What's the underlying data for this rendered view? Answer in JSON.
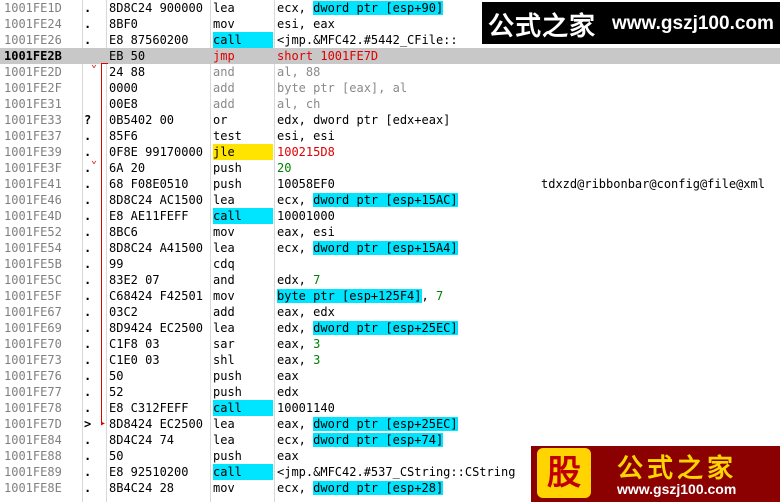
{
  "rows": [
    {
      "addr": "1001FE1D",
      "mark": ".",
      "hex": "8D8C24 900000",
      "mn": "lea",
      "mc": "",
      "ops": [
        {
          "t": "ecx, "
        },
        {
          "t": "dword ptr [esp+90]",
          "c": "hl"
        }
      ],
      "cmt": ""
    },
    {
      "addr": "1001FE24",
      "mark": ".",
      "hex": "8BF0",
      "mn": "mov",
      "mc": "",
      "ops": [
        {
          "t": "esi, eax"
        }
      ],
      "cmt": ""
    },
    {
      "addr": "1001FE26",
      "mark": ".",
      "hex": "E8 87560200",
      "mn": "call",
      "mc": "call",
      "ops": [
        {
          "t": "<jmp.&MFC42.#5442_CFile::"
        }
      ],
      "cmt": ""
    },
    {
      "addr": "1001FE2B",
      "mark": "",
      "hex": "EB 50",
      "mn": "jmp",
      "mc": "jmp",
      "ops": [
        {
          "t": "short 1001FE7D",
          "c": "red"
        }
      ],
      "cmt": "",
      "sel": true
    },
    {
      "addr": "1001FE2D",
      "mark": "",
      "hex": "24 88",
      "mn": "and",
      "mc": "g",
      "ops": [
        {
          "t": "al, 88",
          "c": "g"
        }
      ],
      "cmt": ""
    },
    {
      "addr": "1001FE2F",
      "mark": "",
      "hex": "0000",
      "mn": "add",
      "mc": "g",
      "ops": [
        {
          "t": "byte ptr [eax], al",
          "c": "g"
        }
      ],
      "cmt": ""
    },
    {
      "addr": "1001FE31",
      "mark": "",
      "hex": "00E8",
      "mn": "add",
      "mc": "g",
      "ops": [
        {
          "t": "al, ch",
          "c": "g"
        }
      ],
      "cmt": ""
    },
    {
      "addr": "1001FE33",
      "mark": "?",
      "hex": "0B5402 00",
      "mn": "or",
      "mc": "",
      "ops": [
        {
          "t": "edx, dword ptr [edx+eax]"
        }
      ],
      "cmt": ""
    },
    {
      "addr": "1001FE37",
      "mark": ".",
      "hex": "85F6",
      "mn": "test",
      "mc": "",
      "ops": [
        {
          "t": "esi, esi"
        }
      ],
      "cmt": ""
    },
    {
      "addr": "1001FE39",
      "mark": ".",
      "hex": "0F8E 99170000",
      "mn": "jle",
      "mc": "jle",
      "ops": [
        {
          "t": "100215D8",
          "c": "red"
        }
      ],
      "cmt": ""
    },
    {
      "addr": "1001FE3F",
      "mark": ".",
      "hex": "6A 20",
      "mn": "push",
      "mc": "",
      "ops": [
        {
          "t": "20",
          "c": "green"
        }
      ],
      "cmt": ""
    },
    {
      "addr": "1001FE41",
      "mark": ".",
      "hex": "68 F08E0510",
      "mn": "push",
      "mc": "",
      "ops": [
        {
          "t": "10058EF0"
        }
      ],
      "cmt": "tdxzd@ribbonbar@config@file@xml"
    },
    {
      "addr": "1001FE46",
      "mark": ".",
      "hex": "8D8C24 AC1500",
      "mn": "lea",
      "mc": "",
      "ops": [
        {
          "t": "ecx, "
        },
        {
          "t": "dword ptr [esp+15AC]",
          "c": "hl"
        }
      ],
      "cmt": ""
    },
    {
      "addr": "1001FE4D",
      "mark": ".",
      "hex": "E8 AE11FEFF",
      "mn": "call",
      "mc": "call",
      "ops": [
        {
          "t": "10001000"
        }
      ],
      "cmt": ""
    },
    {
      "addr": "1001FE52",
      "mark": ".",
      "hex": "8BC6",
      "mn": "mov",
      "mc": "",
      "ops": [
        {
          "t": "eax, esi"
        }
      ],
      "cmt": ""
    },
    {
      "addr": "1001FE54",
      "mark": ".",
      "hex": "8D8C24 A41500",
      "mn": "lea",
      "mc": "",
      "ops": [
        {
          "t": "ecx, "
        },
        {
          "t": "dword ptr [esp+15A4]",
          "c": "hl"
        }
      ],
      "cmt": ""
    },
    {
      "addr": "1001FE5B",
      "mark": ".",
      "hex": "99",
      "mn": "cdq",
      "mc": "",
      "ops": [],
      "cmt": ""
    },
    {
      "addr": "1001FE5C",
      "mark": ".",
      "hex": "83E2 07",
      "mn": "and",
      "mc": "",
      "ops": [
        {
          "t": "edx, "
        },
        {
          "t": "7",
          "c": "imm"
        }
      ],
      "cmt": ""
    },
    {
      "addr": "1001FE5F",
      "mark": ".",
      "hex": "C68424 F42501",
      "mn": "mov",
      "mc": "",
      "ops": [
        {
          "t": "byte ptr [esp+125F4]",
          "c": "hl"
        },
        {
          "t": ", "
        },
        {
          "t": "7",
          "c": "imm"
        }
      ],
      "cmt": ""
    },
    {
      "addr": "1001FE67",
      "mark": ".",
      "hex": "03C2",
      "mn": "add",
      "mc": "",
      "ops": [
        {
          "t": "eax, edx"
        }
      ],
      "cmt": ""
    },
    {
      "addr": "1001FE69",
      "mark": ".",
      "hex": "8D9424 EC2500",
      "mn": "lea",
      "mc": "",
      "ops": [
        {
          "t": "edx, "
        },
        {
          "t": "dword ptr [esp+25EC]",
          "c": "hl"
        }
      ],
      "cmt": ""
    },
    {
      "addr": "1001FE70",
      "mark": ".",
      "hex": "C1F8 03",
      "mn": "sar",
      "mc": "",
      "ops": [
        {
          "t": "eax, "
        },
        {
          "t": "3",
          "c": "imm"
        }
      ],
      "cmt": ""
    },
    {
      "addr": "1001FE73",
      "mark": ".",
      "hex": "C1E0 03",
      "mn": "shl",
      "mc": "",
      "ops": [
        {
          "t": "eax, "
        },
        {
          "t": "3",
          "c": "imm"
        }
      ],
      "cmt": ""
    },
    {
      "addr": "1001FE76",
      "mark": ".",
      "hex": "50",
      "mn": "push",
      "mc": "",
      "ops": [
        {
          "t": "eax"
        }
      ],
      "cmt": ""
    },
    {
      "addr": "1001FE77",
      "mark": ".",
      "hex": "52",
      "mn": "push",
      "mc": "",
      "ops": [
        {
          "t": "edx"
        }
      ],
      "cmt": ""
    },
    {
      "addr": "1001FE78",
      "mark": ".",
      "hex": "E8 C312FEFF",
      "mn": "call",
      "mc": "call",
      "ops": [
        {
          "t": "10001140"
        }
      ],
      "cmt": ""
    },
    {
      "addr": "1001FE7D",
      "mark": ">",
      "hex": "8D8424 EC2500",
      "mn": "lea",
      "mc": "",
      "ops": [
        {
          "t": "eax, "
        },
        {
          "t": "dword ptr [esp+25EC]",
          "c": "hl"
        }
      ],
      "cmt": ""
    },
    {
      "addr": "1001FE84",
      "mark": ".",
      "hex": "8D4C24 74",
      "mn": "lea",
      "mc": "",
      "ops": [
        {
          "t": "ecx, "
        },
        {
          "t": "dword ptr [esp+74]",
          "c": "hl"
        }
      ],
      "cmt": ""
    },
    {
      "addr": "1001FE88",
      "mark": ".",
      "hex": "50",
      "mn": "push",
      "mc": "",
      "ops": [
        {
          "t": "eax"
        }
      ],
      "cmt": ""
    },
    {
      "addr": "1001FE89",
      "mark": ".",
      "hex": "E8 92510200",
      "mn": "call",
      "mc": "call",
      "ops": [
        {
          "t": "<jmp.&MFC42.#537_CString::CString"
        }
      ],
      "cmt": ""
    },
    {
      "addr": "1001FE8E",
      "mark": ".",
      "hex": "8B4C24 28",
      "mn": "mov",
      "mc": "",
      "ops": [
        {
          "t": "ecx, "
        },
        {
          "t": "dword ptr [esp+28]",
          "c": "hl"
        }
      ],
      "cmt": ""
    }
  ],
  "watermark_top": {
    "cn": "公式之家",
    "url": "www.gszj100.com"
  },
  "watermark_bottom": {
    "logo": "股",
    "cn": "公式之家",
    "url": "www.gszj100.com"
  }
}
